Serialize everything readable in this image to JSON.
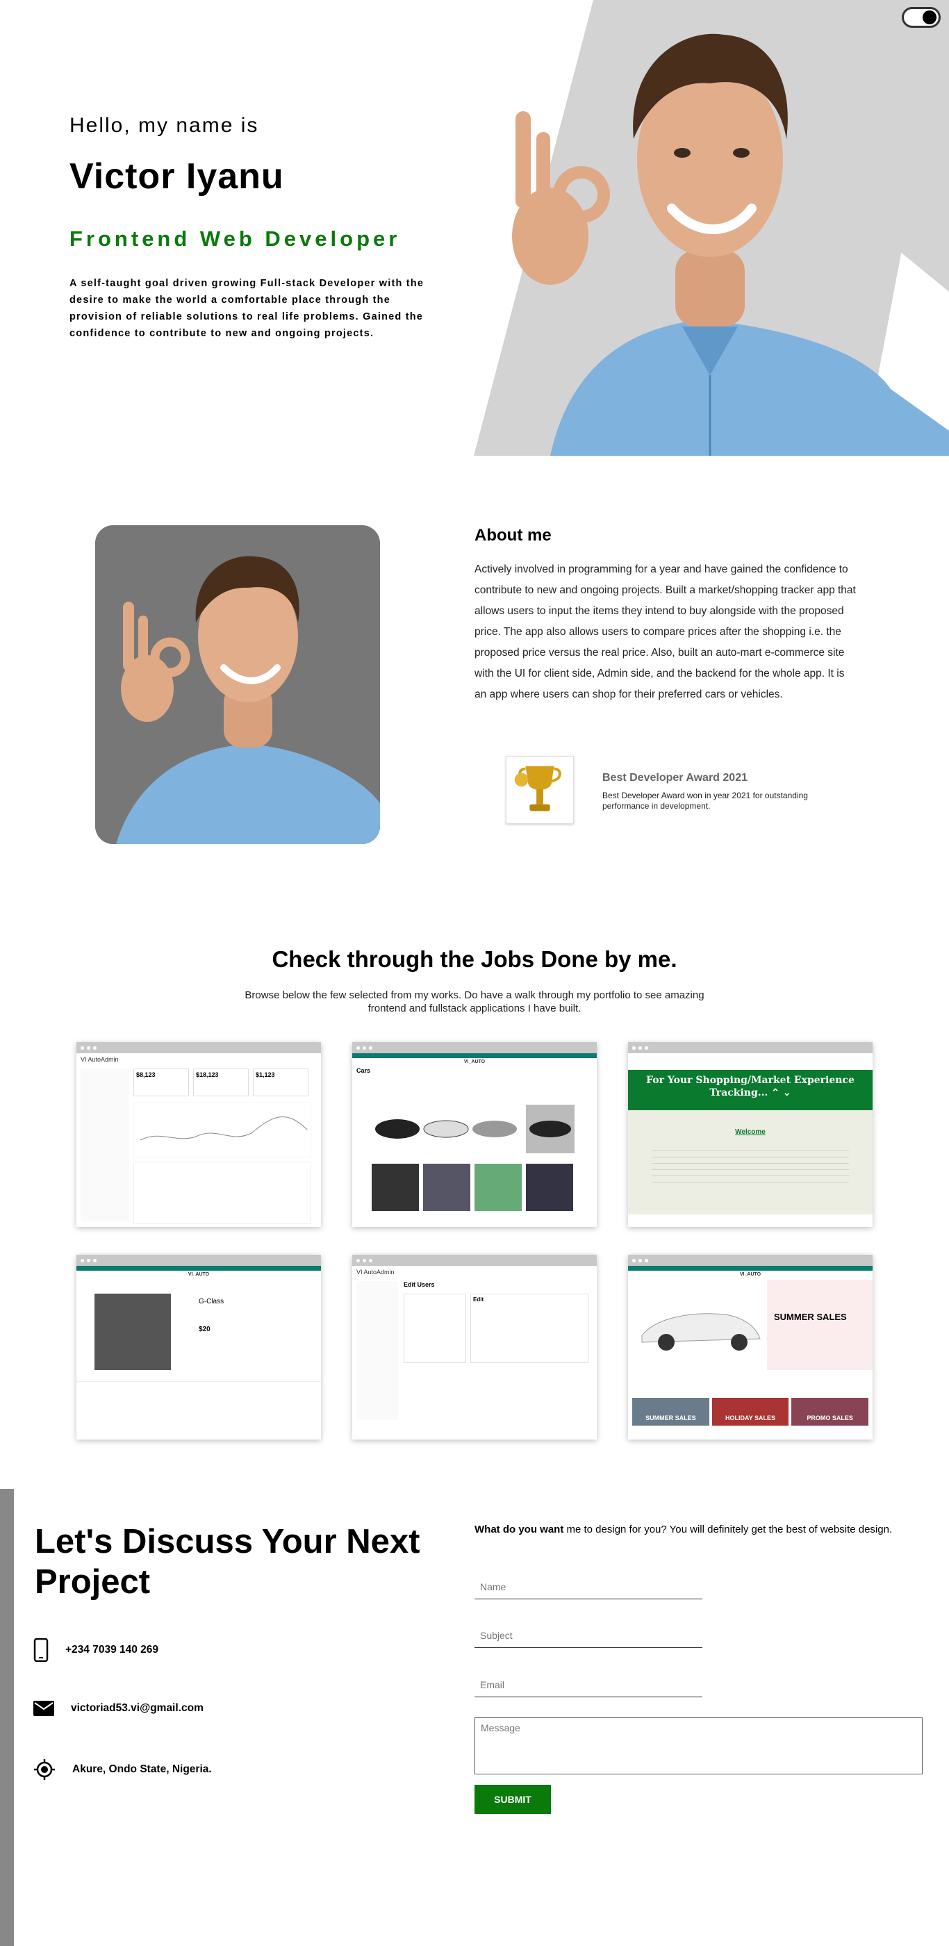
{
  "hero": {
    "greeting": "Hello, my name is",
    "name": "Victor Iyanu",
    "role": "Frontend Web Developer",
    "intro": "A self-taught goal driven growing Full-stack Developer with the desire to make the world a comfortable place through the provision of reliable solutions to real life problems. Gained the confidence to contribute to new and ongoing projects."
  },
  "about": {
    "title": "About me",
    "text": "Actively involved in programming for a year and have gained the confidence to contribute to new and ongoing projects. Built a market/shopping tracker app that allows users to input the items they intend to buy alongside with the proposed price. The app also allows users to compare prices after the shopping i.e. the proposed price versus the real price. Also, built an auto-mart e-commerce site with the UI for client side, Admin side, and the backend for the whole app. It is an app where users can shop for their preferred cars or vehicles.",
    "award_title": "Best Developer Award 2021",
    "award_desc": "Best Developer Award won in year 2021 for outstanding performance in development."
  },
  "jobs": {
    "title": "Check through the Jobs Done by me.",
    "subtitle": "Browse below the few selected from my works. Do have a walk through my portfolio to see amazing frontend and fullstack applications I have built.",
    "admin_brand": "VI AutoAdmin",
    "auto_brand": "VI_AUTO",
    "stat1": "$8,123",
    "stat2": "$18,123",
    "stat3": "$1,123",
    "cars_title": "Cars",
    "shop_title": "For Your Shopping/Market Experience Tracking... ⌃ ⌄",
    "welcome": "Welcome",
    "gclass": "G-Class",
    "price": "$20",
    "edit_users": "Edit Users",
    "edit": "Edit",
    "summer": "SUMMER SALES",
    "summer_lbl": "SUMMER SALES",
    "holiday_lbl": "HOLIDAY SALES",
    "promo_lbl": "PROMO SALES"
  },
  "contact": {
    "title": "Let's Discuss Your Next Project",
    "phone": "+234 7039 140 269",
    "email": "victoriad53.vi@gmail.com",
    "location": "Akure, Ondo State, Nigeria.",
    "intro_bold": "What do you want",
    "intro_rest": " me to design for you? You will definitely get the best of website design.",
    "name_ph": "Name",
    "subject_ph": "Subject",
    "email_ph": "Email",
    "message_ph": "Message",
    "submit": "SUBMIT"
  }
}
